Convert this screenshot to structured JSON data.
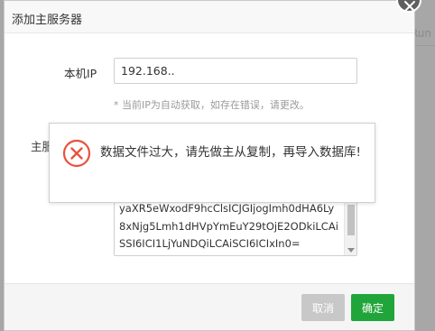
{
  "background": {
    "partial_text": "Run"
  },
  "dialog": {
    "title": "添加主服务器",
    "local_ip_label": "本机IP",
    "local_ip_value": "192.168..",
    "hint": "* 当前IP为自动获取，如存在错误，请更改。",
    "main_label": "主服",
    "textarea_lines": [
      "yaXR5eWxodF9hcClsICJGIjogImh0dHA6Ly",
      "8xNjg5Lmh1dHVpYmEuY29tOjE2ODkiLCAi",
      "SSI6ICI1LjYuNDQiLCAiSCI6ICIxIn0="
    ],
    "buttons": {
      "cancel": "取消",
      "confirm": "确定"
    }
  },
  "toast": {
    "icon": "error-circle-x-icon",
    "message": "数据文件过大，请先做主从复制，再导入数据库!"
  },
  "colors": {
    "confirm_button": "#20a53a",
    "cancel_button": "#c8c8c8",
    "error_icon": "#e8533f",
    "overlay": "#a7a7a7"
  }
}
